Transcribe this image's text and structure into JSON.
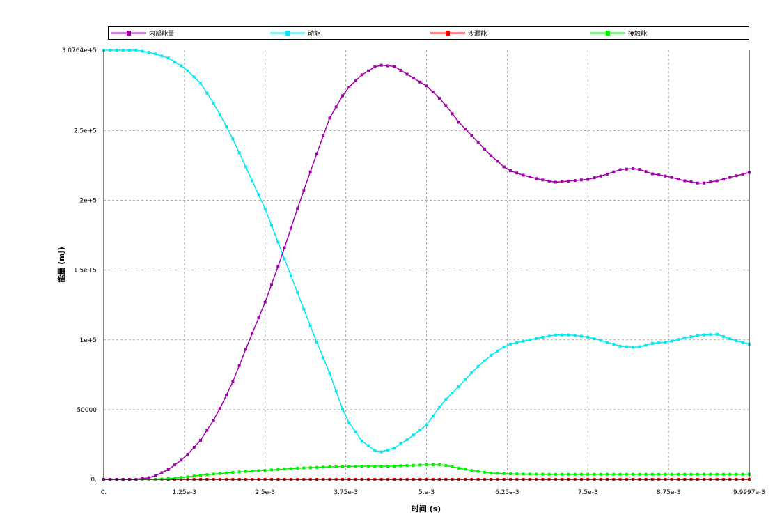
{
  "chart_data": {
    "type": "line",
    "title": "",
    "xlabel": "时间 (s)",
    "ylabel": "能量 (mJ)",
    "xlim": [
      0,
      0.0099997
    ],
    "ylim": [
      0,
      307640
    ],
    "grid": true,
    "legend_position": "top",
    "x_ticks": [
      0,
      0.00125,
      0.0025,
      0.00375,
      0.005,
      0.00625,
      0.0075,
      0.00875,
      0.0099997
    ],
    "x_tick_labels": [
      "0.",
      "1.25e-3",
      "2.5e-3",
      "3.75e-3",
      "5.e-3",
      "6.25e-3",
      "7.5e-3",
      "8.75e-3",
      "9.9997e-3"
    ],
    "y_ticks": [
      0,
      50000,
      100000,
      150000,
      200000,
      250000,
      307640
    ],
    "y_tick_labels": [
      "0.",
      "50000",
      "1e+5",
      "1.5e+5",
      "2e+5",
      "2.5e+5",
      "3.0764e+5"
    ],
    "x": [
      0,
      0.00025,
      0.0005,
      0.00075,
      0.001,
      0.00125,
      0.0015,
      0.00175,
      0.002,
      0.00225,
      0.0025,
      0.00275,
      0.003,
      0.00325,
      0.0035,
      0.00375,
      0.004,
      0.00425,
      0.0045,
      0.00475,
      0.005,
      0.00525,
      0.0055,
      0.00575,
      0.006,
      0.00625,
      0.0065,
      0.00675,
      0.007,
      0.00725,
      0.0075,
      0.00775,
      0.008,
      0.00825,
      0.0085,
      0.00875,
      0.009,
      0.00925,
      0.0095,
      0.00975,
      0.0099997
    ],
    "series": [
      {
        "name": "内部能量",
        "color": "#a000a8",
        "values": [
          0,
          0,
          0,
          1500,
          7000,
          15500,
          28000,
          46000,
          70000,
          99000,
          127000,
          159000,
          194000,
          227000,
          259000,
          279000,
          290000,
          297000,
          296000,
          289000,
          282000,
          271000,
          256000,
          244000,
          232000,
          222000,
          218000,
          215000,
          213000,
          214000,
          215000,
          218000,
          222000,
          223000,
          219000,
          217000,
          214000,
          212000,
          214000,
          217000,
          220000
        ]
      },
      {
        "name": "动能",
        "color": "#00e8f0",
        "values": [
          307640,
          307640,
          307640,
          305700,
          302000,
          295000,
          284000,
          266000,
          244000,
          219000,
          194000,
          164000,
          134000,
          104000,
          76000,
          44000,
          27500,
          19000,
          22500,
          30000,
          39000,
          55000,
          66500,
          79000,
          89000,
          96500,
          99000,
          101500,
          103500,
          103500,
          102000,
          99000,
          95500,
          94500,
          97500,
          98500,
          101500,
          103500,
          104000,
          100000,
          97000
        ]
      },
      {
        "name": "沙漏能",
        "color": "#ff0000",
        "values": [
          0,
          0,
          0,
          0,
          0,
          0,
          0,
          0,
          0,
          0,
          0,
          0,
          0,
          0,
          0,
          0,
          0,
          0,
          0,
          0,
          0,
          0,
          0,
          0,
          0,
          0,
          0,
          0,
          0,
          0,
          0,
          0,
          0,
          0,
          0,
          0,
          0,
          0,
          0,
          0,
          0
        ]
      },
      {
        "name": "接触能",
        "color": "#00f000",
        "values": [
          0,
          0,
          0,
          0,
          500,
          1500,
          3000,
          4000,
          5000,
          5800,
          6500,
          7200,
          8000,
          8500,
          9000,
          9200,
          9500,
          9500,
          9500,
          10000,
          10500,
          10500,
          8000,
          6000,
          4500,
          4000,
          3800,
          3700,
          3600,
          3600,
          3600,
          3600,
          3600,
          3600,
          3600,
          3600,
          3600,
          3600,
          3600,
          3600,
          3600
        ]
      }
    ]
  }
}
